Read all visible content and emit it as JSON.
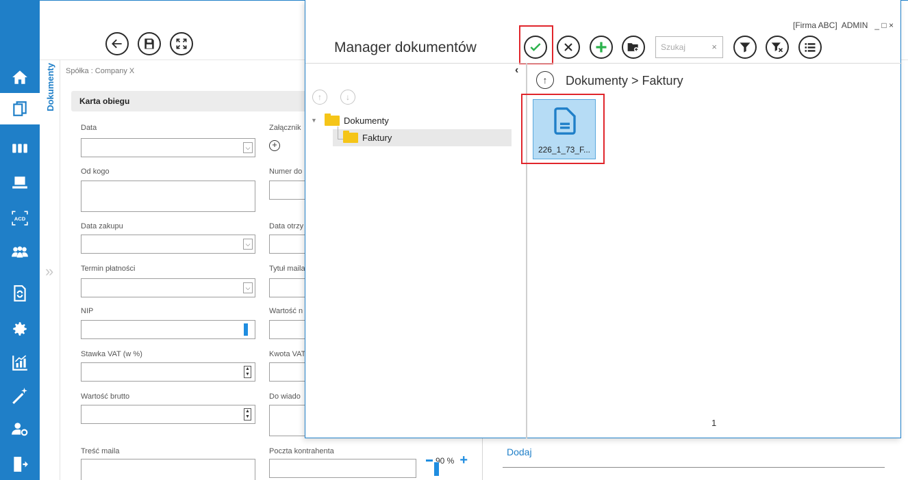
{
  "rail": {
    "items": [
      {
        "name": "home-icon"
      },
      {
        "name": "documents-icon",
        "active": true
      },
      {
        "name": "modules-icon"
      },
      {
        "name": "computer-icon"
      },
      {
        "name": "acd-icon",
        "text": "ACD"
      },
      {
        "name": "team-icon"
      },
      {
        "name": "document-sync-icon"
      },
      {
        "name": "settings-icon"
      },
      {
        "name": "analytics-icon"
      },
      {
        "name": "wand-icon"
      },
      {
        "name": "user-settings-icon"
      },
      {
        "name": "logout-icon"
      }
    ]
  },
  "sidetab": {
    "label": "Dokumenty"
  },
  "breadcrumb": {
    "company": "Spółka : Company X"
  },
  "form": {
    "card_title": "Karta obiegu",
    "labels": {
      "data": "Data",
      "zalacznik": "Załącznik",
      "od_kogo": "Od kogo",
      "numer": "Numer do",
      "data_zakupu": "Data zakupu",
      "data_otrzy": "Data otrzy",
      "termin": "Termin płatności",
      "tytul": "Tytuł maila",
      "nip": "NIP",
      "wartosc_n": "Wartość n",
      "stawka": "Stawka VAT (w %)",
      "kwota": "Kwota VAT",
      "brutto": "Wartość brutto",
      "do_wiad": "Do wiado",
      "tresc": "Treść maila",
      "poczta": "Poczta kontrahenta"
    }
  },
  "zoom": {
    "value": "90 %"
  },
  "dodaj_label": "Dodaj",
  "modal": {
    "title": "Manager dokumentów",
    "company": "[Firma ABC]",
    "user": "ADMIN",
    "window_controls": "_ □ ×",
    "search_placeholder": "Szukaj",
    "search_clear": "×",
    "tree": {
      "root": "Dokumenty",
      "child": "Faktury"
    },
    "path": "Dokumenty > Faktury",
    "file": {
      "name": "226_1_73_F..."
    },
    "page": "1",
    "accent": "#1f7fc8",
    "highlight": "#e0252b"
  }
}
